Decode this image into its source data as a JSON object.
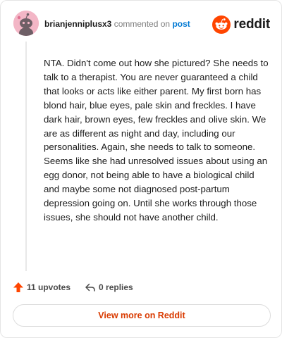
{
  "comment": {
    "username": "brianjenniplusx3",
    "action_text": "commented on",
    "post_link": "post",
    "body": "NTA. Didn't come out how she pictured? She needs to talk to a therapist. You are never guaranteed a child that looks or acts like either parent. My first born has blond hair, blue eyes, pale skin and freckles. I have dark hair, brown eyes, few freckles and olive skin. We are as different as night and day, including our personalities. Again, she needs to talk to someone. Seems like she had unresolved issues about using an egg donor, not being able to have a biological child and maybe some not diagnosed post-partum depression going on. Until she works through those issues, she should not have another child."
  },
  "brand": {
    "wordmark": "reddit",
    "icon": "reddit-snoo-icon",
    "color": "#ff4500"
  },
  "actions": {
    "upvotes": "11 upvotes",
    "replies": "0 replies"
  },
  "footer": {
    "view_more": "View more on Reddit"
  },
  "colors": {
    "accent": "#d93a00",
    "link": "#0079d3",
    "avatar_bg": "#f3b6c6"
  }
}
